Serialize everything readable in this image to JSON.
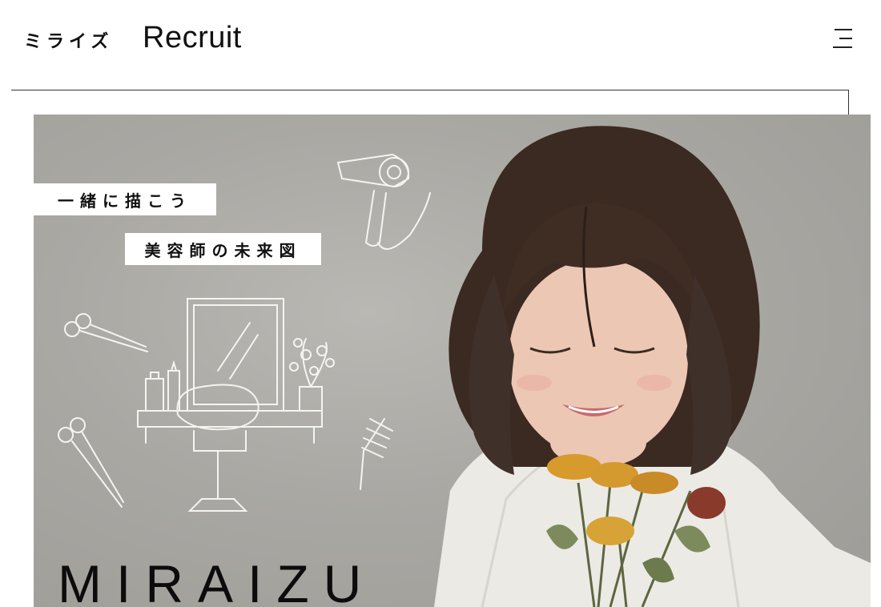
{
  "header": {
    "logo_jp": "ミライズ",
    "logo_recruit": "Recruit",
    "menu_icon": "hamburger-menu-icon"
  },
  "hero": {
    "tagline_1": "一緒に描こう",
    "tagline_2": "美容師の未来図",
    "brand": "MIRAIZU",
    "illustrations": [
      "hair-dryer-icon",
      "scissors-icon",
      "scissors-icon",
      "salon-chair-icon",
      "mirror-icon",
      "bottle-icon",
      "plant-icon",
      "round-brush-icon"
    ],
    "photo": "woman-with-flowers-photo"
  },
  "colors": {
    "background": "#ffffff",
    "hero_wall": "#aaa9a4",
    "text": "#111111"
  }
}
